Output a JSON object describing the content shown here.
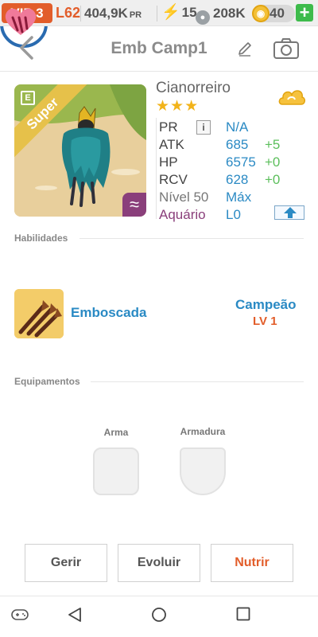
{
  "topbar": {
    "vip": "VIP 3",
    "level": "L62",
    "power": "404,9K",
    "power_unit": "PR",
    "energy": "15",
    "coins": "208K",
    "gems": "40",
    "add_label": "+"
  },
  "header": {
    "title": "Emb Camp1"
  },
  "monster": {
    "name": "Cianorreiro",
    "stars": "★★★",
    "tier_ribbon": "Super",
    "pr_label": "PR",
    "pr_info": "i",
    "pr_value": "N/A",
    "atk_label": "ATK",
    "atk_value": "685",
    "atk_bonus": "+5",
    "hp_label": "HP",
    "hp_value": "6575",
    "hp_bonus": "+0",
    "rcv_label": "RCV",
    "rcv_value": "628",
    "rcv_bonus": "+0",
    "level_label": "Nível 50",
    "level_value": "Máx",
    "element_label": "Aquário",
    "element_level": "L0",
    "element_color": "#8a3f7b"
  },
  "skills": {
    "section_title": "Habilidades",
    "items": [
      {
        "name": "Emboscada",
        "icon": "arrows-icon"
      },
      {
        "name": "Campeão",
        "level": "LV 1",
        "icon": "heart-claw-icon"
      }
    ]
  },
  "equipment": {
    "section_title": "Equipamentos",
    "weapon_label": "Arma",
    "armor_label": "Armadura"
  },
  "actions": {
    "manage": "Gerir",
    "evolve": "Evoluir",
    "feed": "Nutrir"
  },
  "colors": {
    "accent": "#e25d2a",
    "link": "#2b8ac4",
    "bonus": "#5cbf5c"
  }
}
